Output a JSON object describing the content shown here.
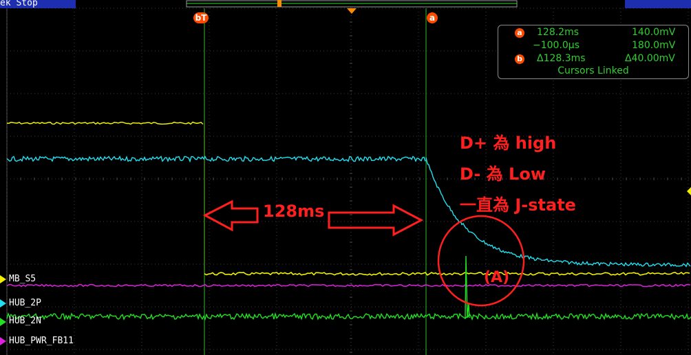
{
  "status": {
    "text": "ek Stop"
  },
  "colors": {
    "yellow": "#f0f000",
    "cyan": "#22e0f0",
    "magenta": "#e020e0",
    "green": "#22e022",
    "cursor_line": "#2dbb2d",
    "annotation_red": "#ff1f1f",
    "badge_orange": "#ff4a00",
    "readout_text": "#2fd02f"
  },
  "cursors": {
    "a_badge": "a",
    "b_badge": "b",
    "bt_badge": "bT"
  },
  "readout": {
    "a_label": "a",
    "b_label": "b",
    "row1_time": "128.2ms",
    "row1_volt": "140.0mV",
    "row2_time": "−100.0μs",
    "row2_volt": "180.0mV",
    "row3_time": "Δ128.3ms",
    "row3_volt": "Δ40.00mV",
    "linked": "Cursors Linked"
  },
  "annotations": {
    "line1": "D+ 為 high",
    "line2": "D-  為 Low",
    "line3": "一直為 J-state",
    "interval": "128ms",
    "circle_label": "(A)"
  },
  "channels": [
    {
      "label": "MB_S5",
      "color": "#f0f000"
    },
    {
      "label": "HUB_2P",
      "color": "#22e0f0"
    },
    {
      "label": "HUB_2N",
      "color": "#22e022"
    },
    {
      "label": "HUB_PWR_FB11",
      "color": "#e020e0"
    }
  ]
}
